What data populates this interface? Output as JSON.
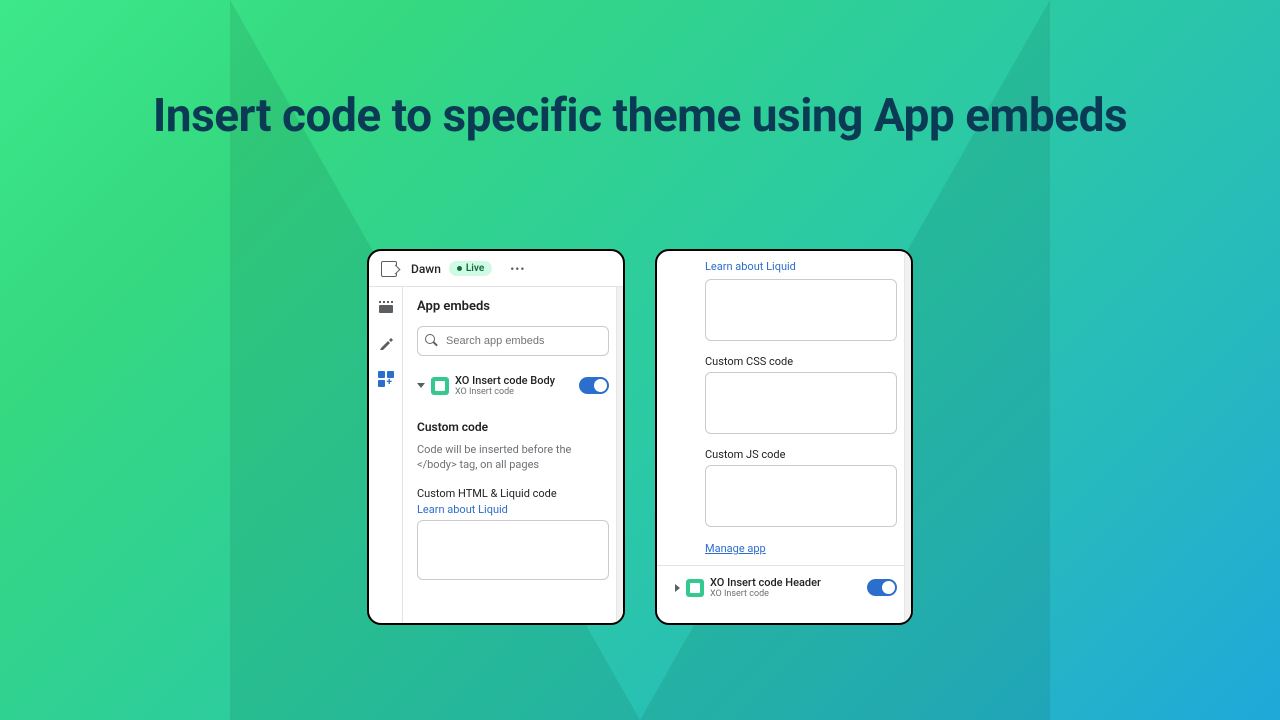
{
  "headline": "Insert code to specific theme using App embeds",
  "panel1": {
    "theme_name": "Dawn",
    "live_label": "Live",
    "section_title": "App embeds",
    "search_placeholder": "Search app embeds",
    "embed": {
      "title": "XO Insert code Body",
      "subtitle": "XO Insert code"
    },
    "custom_code_title": "Custom code",
    "custom_code_help": "Code will be inserted before the </body> tag, on all pages",
    "html_label": "Custom HTML & Liquid code",
    "liquid_link": "Learn about Liquid"
  },
  "panel2": {
    "liquid_link": "Learn about Liquid",
    "css_label": "Custom CSS code",
    "js_label": "Custom JS code",
    "manage_link": "Manage app",
    "embed": {
      "title": "XO Insert code Header",
      "subtitle": "XO Insert code"
    }
  }
}
